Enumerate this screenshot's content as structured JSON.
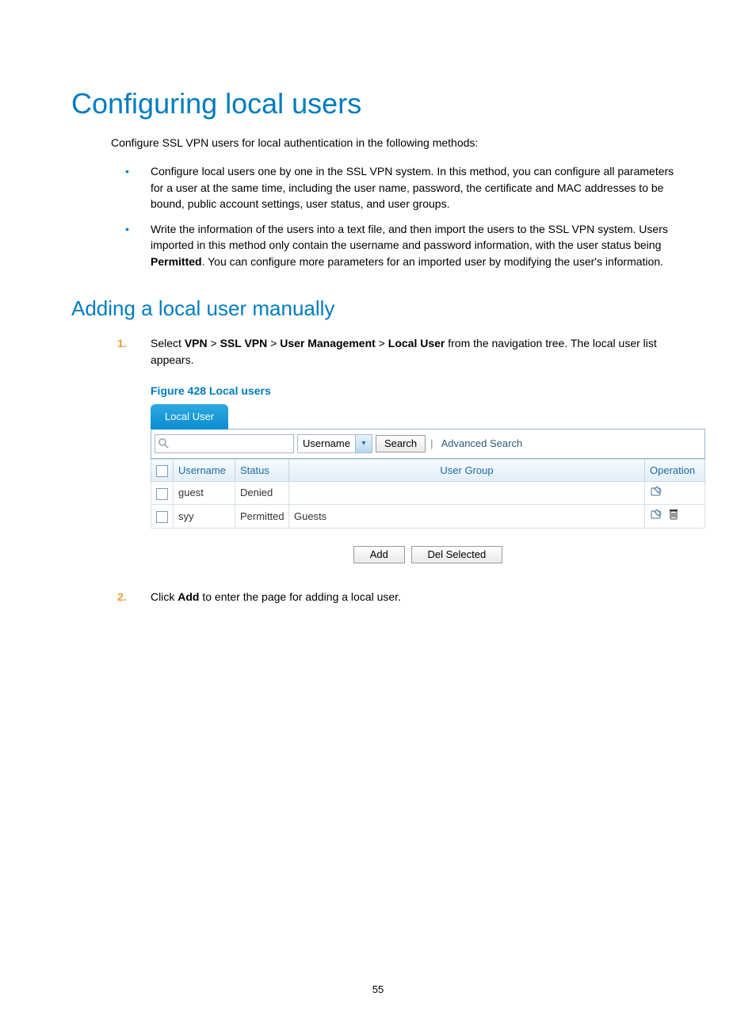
{
  "title": "Configuring local users",
  "intro": "Configure SSL VPN users for local authentication in the following methods:",
  "bullets": [
    "Configure local users one by one in the SSL VPN system. In this method, you can configure all parameters for a user at the same time, including the user name, password, the certificate and MAC addresses to be bound, public account settings, user status, and user groups.",
    "Write the information of the users into a text file, and then import the users to the SSL VPN system. Users imported in this method only contain the username and password information, with the user status being "
  ],
  "bullet2_bold": "Permitted",
  "bullet2_tail": ". You can configure more parameters for an imported user by modifying the user's information.",
  "subtitle": "Adding a local user manually",
  "steps": {
    "s1_num": "1.",
    "s1_pre": "Select ",
    "s1_b1": "VPN",
    "s1_gt": " > ",
    "s1_b2": "SSL VPN",
    "s1_b3": "User Management",
    "s1_b4": "Local User",
    "s1_post": " from the navigation tree. The local user list appears.",
    "s2_num": "2.",
    "s2_pre": "Click ",
    "s2_b": "Add",
    "s2_post": " to enter the page for adding a local user."
  },
  "figure_caption": "Figure 428 Local users",
  "figure": {
    "tab_label": "Local User",
    "dropdown_value": "Username",
    "search_button": "Search",
    "advanced_link": "Advanced Search",
    "columns": {
      "username": "Username",
      "status": "Status",
      "usergroup": "User Group",
      "operation": "Operation"
    },
    "rows": [
      {
        "username": "guest",
        "status": "Denied",
        "group": "",
        "delete": false
      },
      {
        "username": "syy",
        "status": "Permitted",
        "group": "Guests",
        "delete": true
      }
    ],
    "add_button": "Add",
    "del_button": "Del Selected"
  },
  "page_number": "55"
}
